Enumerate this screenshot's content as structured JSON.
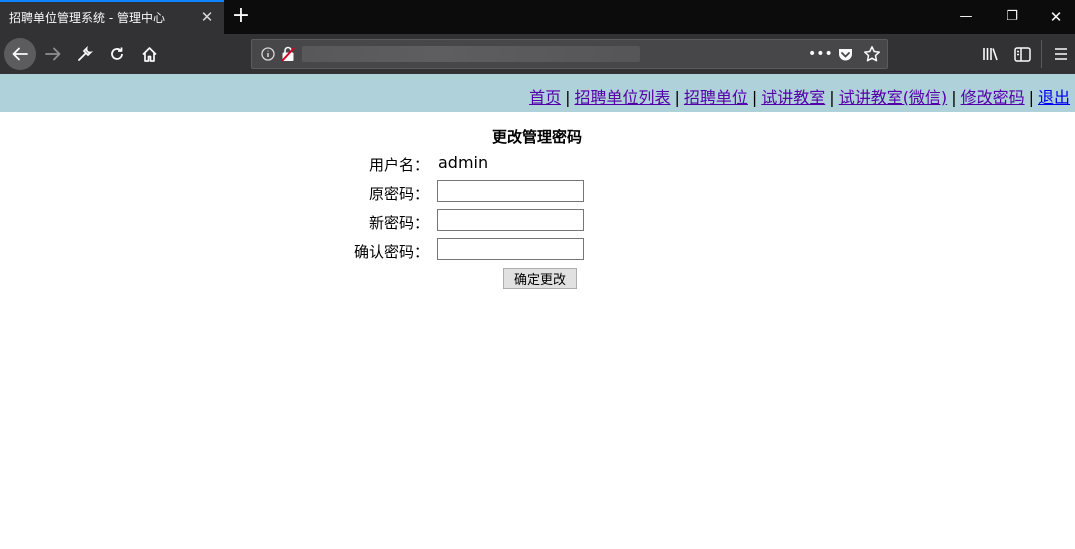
{
  "browser": {
    "tab_title": "招聘单位管理系统 - 管理中心",
    "tab_close": "✕",
    "new_tab": "+",
    "url_dots": "•••",
    "window": {
      "minimize": "—",
      "restore": "❐",
      "close": "✕"
    }
  },
  "nav": {
    "links": [
      "首页",
      "招聘单位列表",
      "招聘单位",
      "试讲教室",
      "试讲教室(微信)",
      "修改密码",
      "退出"
    ],
    "separator": "|"
  },
  "form": {
    "title": "更改管理密码",
    "username_label": "用户名：",
    "username_value": "admin",
    "old_password_label": "原密码：",
    "new_password_label": "新密码：",
    "confirm_password_label": "确认密码：",
    "submit_label": "确定更改"
  }
}
